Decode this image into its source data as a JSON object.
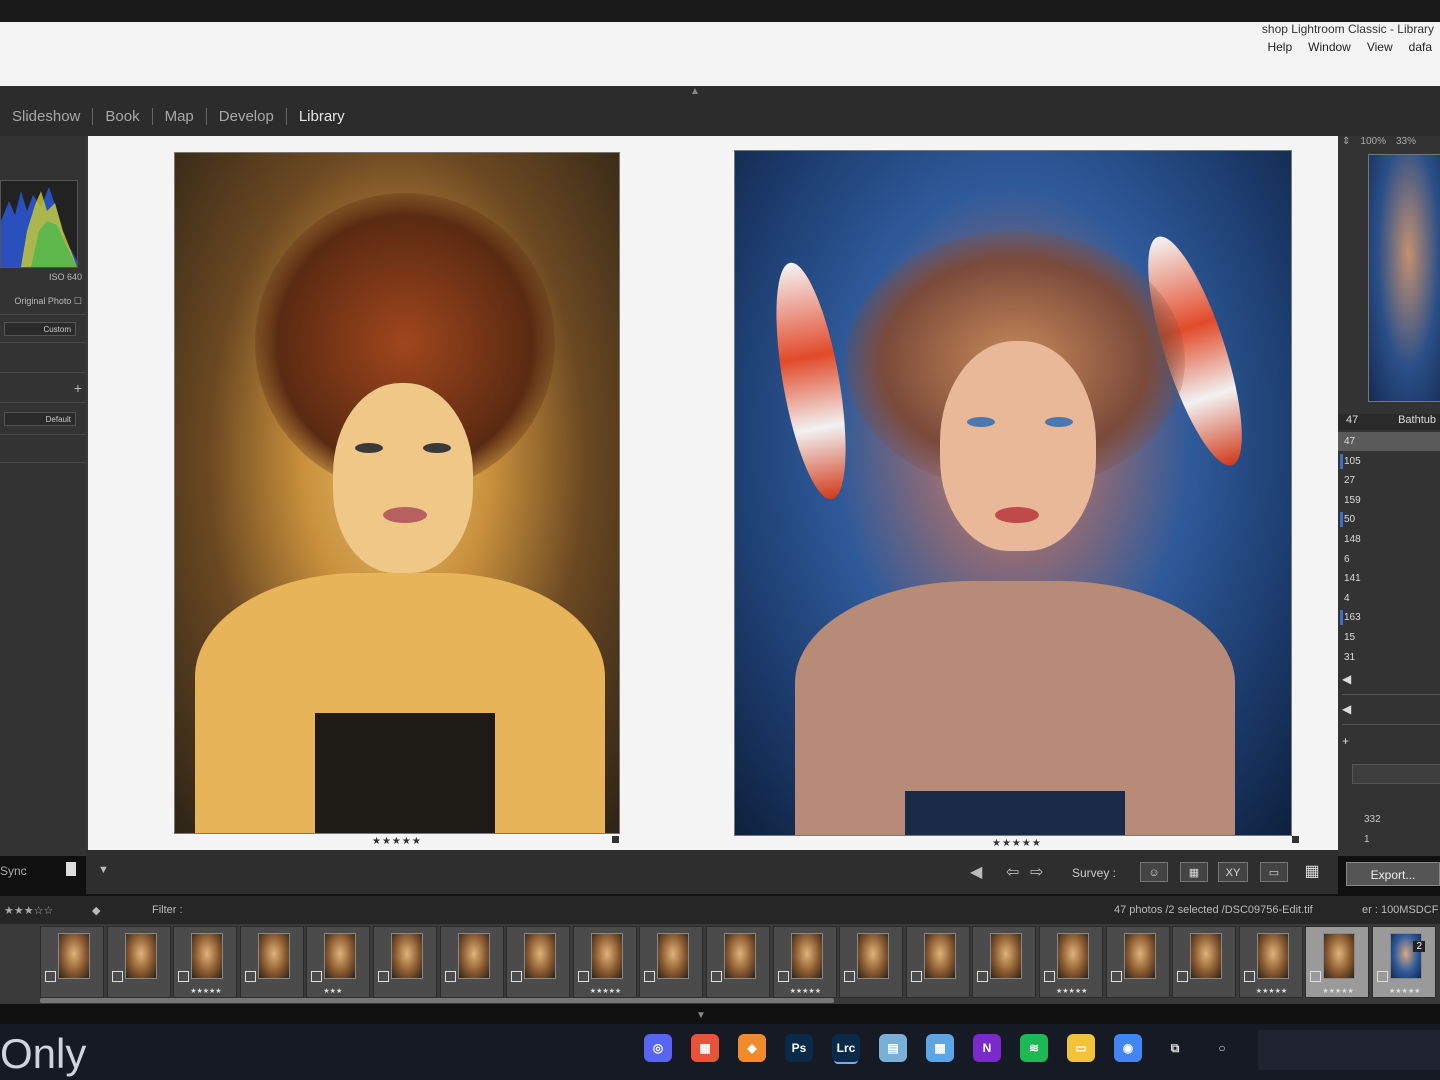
{
  "window": {
    "title": "shop Lightroom Classic - Library",
    "menu": [
      "dafa",
      "View",
      "Window",
      "Help"
    ]
  },
  "modules": [
    "Slideshow",
    "Book",
    "Map",
    "Develop",
    "Library"
  ],
  "active_module": "Library",
  "left_panel": {
    "histogram_info": "ISO 640",
    "original_photo_label": "Original Photo",
    "custom_label": "Custom",
    "default_label": "Default",
    "sync_label": "Sync"
  },
  "navigator": {
    "zoom_options": [
      "100%",
      "33%"
    ]
  },
  "collections": {
    "header_label": "Bathtub",
    "header_count": "47",
    "counts": [
      "47",
      "105",
      "27",
      "159",
      "50",
      "148",
      "6",
      "141",
      "4",
      "163",
      "15",
      "31"
    ],
    "selected_index": 0,
    "marked_indexes": [
      1,
      4,
      9
    ],
    "extra_values": [
      "332",
      "1"
    ]
  },
  "main": {
    "left_stars": "★★★★★",
    "right_stars": "★★★★★"
  },
  "toolbar": {
    "survey_label": "Survey :",
    "export_label": "Export..."
  },
  "filmstrip_info": {
    "source": "er : 100MSDCF",
    "count": "47 photos /2 selected /DSC09756-Edit.tif",
    "filter_label": "Filter :"
  },
  "filmstrip": {
    "cell_count": 21,
    "selected_cells": [
      0,
      1
    ],
    "first_cell_badge": "2",
    "cell_stars": [
      "★★★★★",
      "★★★★★",
      "★★★★★",
      "",
      "",
      "★★★★★",
      "",
      "",
      "",
      "★★★★★",
      "",
      "",
      "★★★★★",
      "",
      "",
      "",
      "★★★",
      "",
      "★★★★★",
      "",
      ""
    ]
  },
  "taskbar": {
    "overlay_text": "Only",
    "apps": [
      "Discord",
      "Calendar",
      "Sketch",
      "Ps",
      "Lrc",
      "Notes",
      "Calculator",
      "N",
      "Spotify",
      "Files",
      "Chrome",
      "Task View",
      "Search"
    ],
    "app_colors": {
      "Discord": "#5865f2",
      "Calendar": "#e8533a",
      "Sketch": "#f08a2a",
      "Ps": "#0a2a4a",
      "Lrc": "#0a2a4a",
      "Notes": "#7ab0d8",
      "Calculator": "#5aa6e8",
      "N": "#7a2acb",
      "Spotify": "#1db954",
      "Files": "#f2c23a",
      "Chrome": "#4285f4"
    }
  }
}
